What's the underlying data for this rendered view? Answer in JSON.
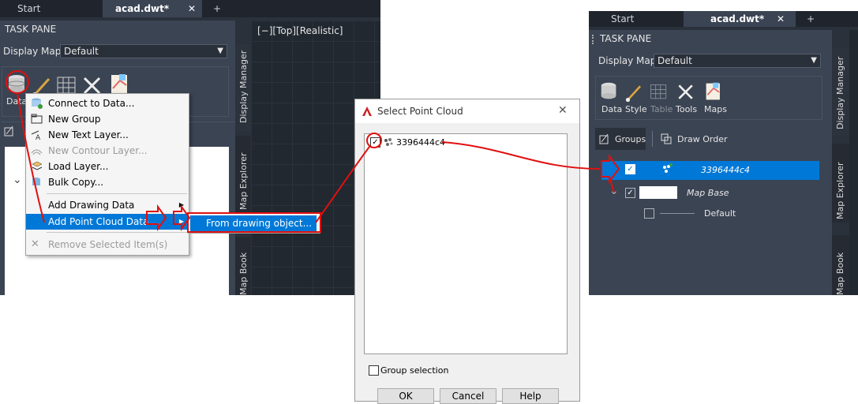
{
  "left": {
    "tabs": {
      "start": "Start",
      "file": "acad.dwt*",
      "close": "✕",
      "plus": "+"
    },
    "task_pane": "TASK PANE",
    "display_map_label": "Display Map:",
    "display_map_value": "Default",
    "viewport_label": "[−][Top][Realistic]",
    "data_label": "Data",
    "vtabs": {
      "display_manager": "Display Manager",
      "map_explorer": "Map Explorer",
      "map_book": "Map Book"
    }
  },
  "menu": {
    "items": [
      {
        "label": "Connect to Data..."
      },
      {
        "label": "New Group"
      },
      {
        "label": "New Text Layer..."
      },
      {
        "label": "New Contour Layer..."
      },
      {
        "label": "Load Layer..."
      },
      {
        "label": "Bulk Copy..."
      },
      {
        "label": "Add Drawing Data"
      },
      {
        "label": "Add Point Cloud Data"
      },
      {
        "label": "Remove Selected Item(s)"
      }
    ],
    "submenu_item": "From drawing object..."
  },
  "dialog": {
    "title": "Select Point Cloud",
    "item": "3396444c4",
    "group_selection": "Group selection",
    "ok": "OK",
    "cancel": "Cancel",
    "help": "Help"
  },
  "right": {
    "tabs": {
      "start": "Start",
      "file": "acad.dwt*",
      "close": "✕",
      "plus": "+"
    },
    "task_pane": "TASK PANE",
    "display_map_label": "Display Map:",
    "display_map_value": "Default",
    "tools": [
      "Data",
      "Style",
      "Table",
      "Tools",
      "Maps"
    ],
    "groups": "Groups",
    "draw_order": "Draw Order",
    "layers": {
      "item": "3396444c4",
      "map_base": "Map Base",
      "default": "Default"
    },
    "vtabs": {
      "display_manager": "Display Manager",
      "map_explorer": "Map Explorer",
      "map_book": "Map Book"
    }
  },
  "colors": {
    "highlight": "#0078d7",
    "annotation": "#e01010",
    "panel": "#3b4453"
  }
}
